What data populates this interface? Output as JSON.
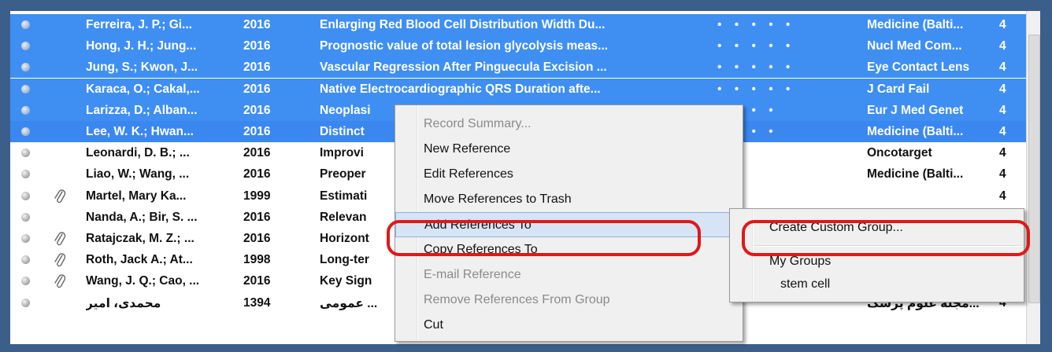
{
  "references": [
    {
      "selected": true,
      "attachment": false,
      "author": "Ferreira, J. P.; Gi...",
      "year": "2016",
      "title": "Enlarging Red Blood Cell Distribution Width Du...",
      "rating": "• • • • •",
      "journal": "Medicine (Balti...",
      "num": "4"
    },
    {
      "selected": true,
      "attachment": false,
      "author": "Hong, J. H.; Jung...",
      "year": "2016",
      "title": "Prognostic value of total lesion glycolysis meas...",
      "rating": "• • • • •",
      "journal": "Nucl Med Com...",
      "num": "4"
    },
    {
      "selected": true,
      "attachment": false,
      "author": "Jung, S.; Kwon, J...",
      "year": "2016",
      "title": "Vascular Regression After Pinguecula Excision ...",
      "rating": "• • • • •",
      "journal": "Eye Contact Lens",
      "num": "4"
    },
    {
      "selected": true,
      "attachment": false,
      "author": "Karaca, O.; Cakal,...",
      "year": "2016",
      "title": "Native Electrocardiographic QRS Duration afte...",
      "rating": "• • • • •",
      "journal": "J Card Fail",
      "num": "4"
    },
    {
      "selected": true,
      "attachment": false,
      "author": "Larizza, D.; Alban...",
      "year": "2016",
      "title": "Neoplasi",
      "rating": "• • • •",
      "journal": "Eur J Med Genet",
      "num": "4"
    },
    {
      "selected": true,
      "attachment": false,
      "author": "Lee, W. K.; Hwan...",
      "year": "2016",
      "title": "Distinct",
      "rating": "• • • •",
      "journal": "Medicine (Balti...",
      "num": "4"
    },
    {
      "selected": false,
      "attachment": false,
      "author": "Leonardi, D. B.; ...",
      "year": "2016",
      "title": "Improvi",
      "rating": "",
      "journal": "Oncotarget",
      "num": "4"
    },
    {
      "selected": false,
      "attachment": false,
      "author": "Liao, W.; Wang, ...",
      "year": "2016",
      "title": "Preoper",
      "rating": "",
      "journal": "Medicine (Balti...",
      "num": "4"
    },
    {
      "selected": false,
      "attachment": true,
      "author": "Martel, Mary Ka...",
      "year": "1999",
      "title": "Estimati",
      "rating": "",
      "journal": "",
      "num": "4"
    },
    {
      "selected": false,
      "attachment": false,
      "author": "Nanda, A.; Bir, S. ...",
      "year": "2016",
      "title": "Relevan",
      "rating": "",
      "journal": "",
      "num": ""
    },
    {
      "selected": false,
      "attachment": true,
      "author": "Ratajczak, M. Z.; ...",
      "year": "2016",
      "title": "Horizont",
      "rating": "",
      "journal": "",
      "num": ""
    },
    {
      "selected": false,
      "attachment": true,
      "author": "Roth, Jack A.; At...",
      "year": "1998",
      "title": "Long-ter",
      "rating": "",
      "journal": "",
      "num": ""
    },
    {
      "selected": false,
      "attachment": true,
      "author": "Wang, J. Q.; Cao, ...",
      "year": "2016",
      "title": "Key Sign",
      "rating": "",
      "journal": "",
      "num": ""
    },
    {
      "selected": false,
      "attachment": false,
      "author": "محمدی، امیر",
      "year": "1394",
      "title": "... عمومی",
      "rating": "",
      "journal": "...مجله علوم پزشک",
      "num": "4",
      "rtl": true
    }
  ],
  "context_menu": {
    "items": [
      {
        "label": "Record Summary...",
        "disabled": true
      },
      {
        "label": "New Reference",
        "disabled": false
      },
      {
        "label": "Edit References",
        "disabled": false
      },
      {
        "label": "Move References to Trash",
        "disabled": false
      },
      {
        "label": "Add References To",
        "disabled": false,
        "submenu": true,
        "highlighted": true
      },
      {
        "label": "Copy References To",
        "disabled": false,
        "submenu": true
      },
      {
        "label": "E-mail Reference",
        "disabled": true
      },
      {
        "label": "Remove References From Group",
        "disabled": true
      },
      {
        "label": "Cut",
        "disabled": false
      }
    ]
  },
  "submenu": {
    "create_group": "Create Custom Group...",
    "my_groups": "My Groups",
    "group_stem_cell": "stem cell"
  },
  "colors": {
    "selection": "#3f8ff3",
    "annotation": "#e01818",
    "menu_bg": "#f0f0f0"
  }
}
